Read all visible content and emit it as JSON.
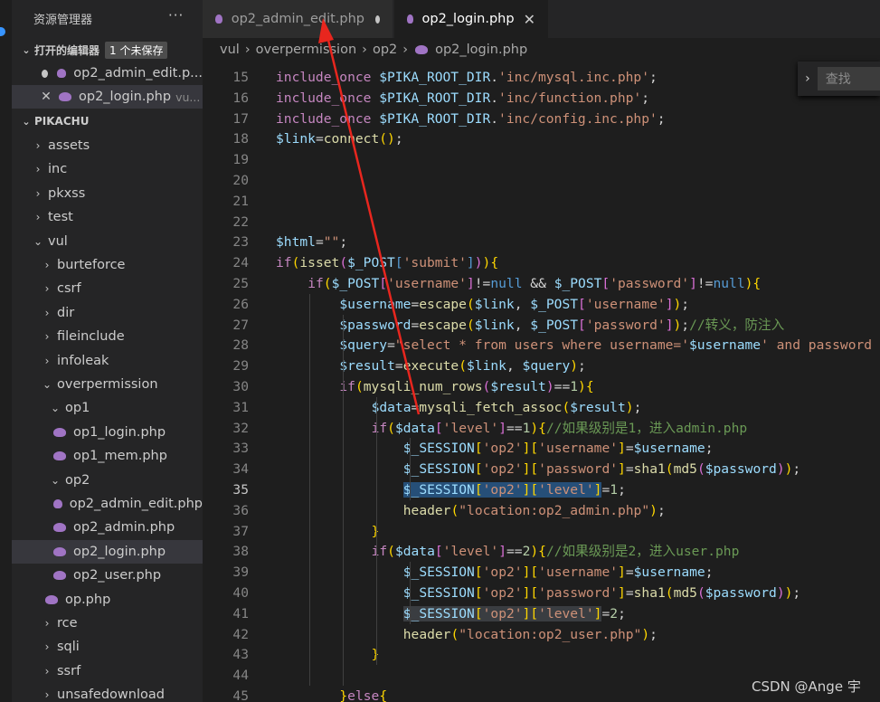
{
  "sidebar": {
    "title": "资源管理器",
    "more": "···",
    "open_editors": {
      "label": "打开的编辑器",
      "badge": "1 个未保存",
      "items": [
        {
          "name": "op2_admin_edit.p...",
          "desc": ""
        },
        {
          "name": "op2_login.php",
          "desc": "vu..."
        }
      ]
    },
    "workspace": "PIKACHU",
    "tree": [
      {
        "label": "assets"
      },
      {
        "label": "inc"
      },
      {
        "label": "pkxss"
      },
      {
        "label": "test"
      },
      {
        "label": "vul"
      },
      {
        "label": "burteforce"
      },
      {
        "label": "csrf"
      },
      {
        "label": "dir"
      },
      {
        "label": "fileinclude"
      },
      {
        "label": "infoleak"
      },
      {
        "label": "overpermission"
      },
      {
        "label": "op1"
      },
      {
        "label": "op1_login.php"
      },
      {
        "label": "op1_mem.php"
      },
      {
        "label": "op2"
      },
      {
        "label": "op2_admin_edit.php"
      },
      {
        "label": "op2_admin.php"
      },
      {
        "label": "op2_login.php"
      },
      {
        "label": "op2_user.php"
      },
      {
        "label": "op.php"
      },
      {
        "label": "rce"
      },
      {
        "label": "sqli"
      },
      {
        "label": "ssrf"
      },
      {
        "label": "unsafedownload"
      }
    ]
  },
  "tabs": [
    {
      "label": "op2_admin_edit.php",
      "state": "unsaved"
    },
    {
      "label": "op2_login.php",
      "state": "active",
      "close": "✕"
    }
  ],
  "breadcrumb": [
    "vul",
    "overpermission",
    "op2",
    "op2_login.php"
  ],
  "find": {
    "placeholder": "查找"
  },
  "watermark": "CSDN @Ange 宇",
  "editor": {
    "current_line": 35,
    "lines": [
      {
        "n": "15",
        "code": "include_once $PIKA_ROOT_DIR.'inc/mysql.inc.php';"
      },
      {
        "n": "16",
        "code": "include_once $PIKA_ROOT_DIR.'inc/function.php';"
      },
      {
        "n": "17",
        "code": "include_once $PIKA_ROOT_DIR.'inc/config.inc.php';"
      },
      {
        "n": "18",
        "code": "$link=connect();"
      },
      {
        "n": "19",
        "code": ""
      },
      {
        "n": "20",
        "code": ""
      },
      {
        "n": "21",
        "code": ""
      },
      {
        "n": "22",
        "code": ""
      },
      {
        "n": "23",
        "code": "$html=\"\";"
      },
      {
        "n": "24",
        "code": "if(isset($_POST['submit'])){"
      },
      {
        "n": "25",
        "code": "    if($_POST['username']!=null && $_POST['password']!=null){"
      },
      {
        "n": "26",
        "code": "        $username=escape($link, $_POST['username']);"
      },
      {
        "n": "27",
        "code": "        $password=escape($link, $_POST['password']);//转义，防注入"
      },
      {
        "n": "28",
        "code": "        $query=\"select * from users where username='$username' and password"
      },
      {
        "n": "29",
        "code": "        $result=execute($link, $query);"
      },
      {
        "n": "30",
        "code": "        if(mysqli_num_rows($result)==1){"
      },
      {
        "n": "31",
        "code": "            $data=mysqli_fetch_assoc($result);"
      },
      {
        "n": "32",
        "code": "            if($data['level']==1){//如果级别是1，进入admin.php"
      },
      {
        "n": "33",
        "code": "                $_SESSION['op2']['username']=$username;"
      },
      {
        "n": "34",
        "code": "                $_SESSION['op2']['password']=sha1(md5($password));"
      },
      {
        "n": "35",
        "code": "                $_SESSION['op2']['level']=1;"
      },
      {
        "n": "36",
        "code": "                header(\"location:op2_admin.php\");"
      },
      {
        "n": "37",
        "code": "            }"
      },
      {
        "n": "38",
        "code": "            if($data['level']==2){//如果级别是2，进入user.php"
      },
      {
        "n": "39",
        "code": "                $_SESSION['op2']['username']=$username;"
      },
      {
        "n": "40",
        "code": "                $_SESSION['op2']['password']=sha1(md5($password));"
      },
      {
        "n": "41",
        "code": "                $_SESSION['op2']['level']=2;"
      },
      {
        "n": "42",
        "code": "                header(\"location:op2_user.php\");"
      },
      {
        "n": "43",
        "code": "            }"
      },
      {
        "n": "44",
        "code": ""
      },
      {
        "n": "45",
        "code": "        }else{"
      }
    ]
  },
  "colors": {
    "accent": "#3794ff",
    "php_icon": "#a074c4",
    "arrow": "#e8261e"
  }
}
